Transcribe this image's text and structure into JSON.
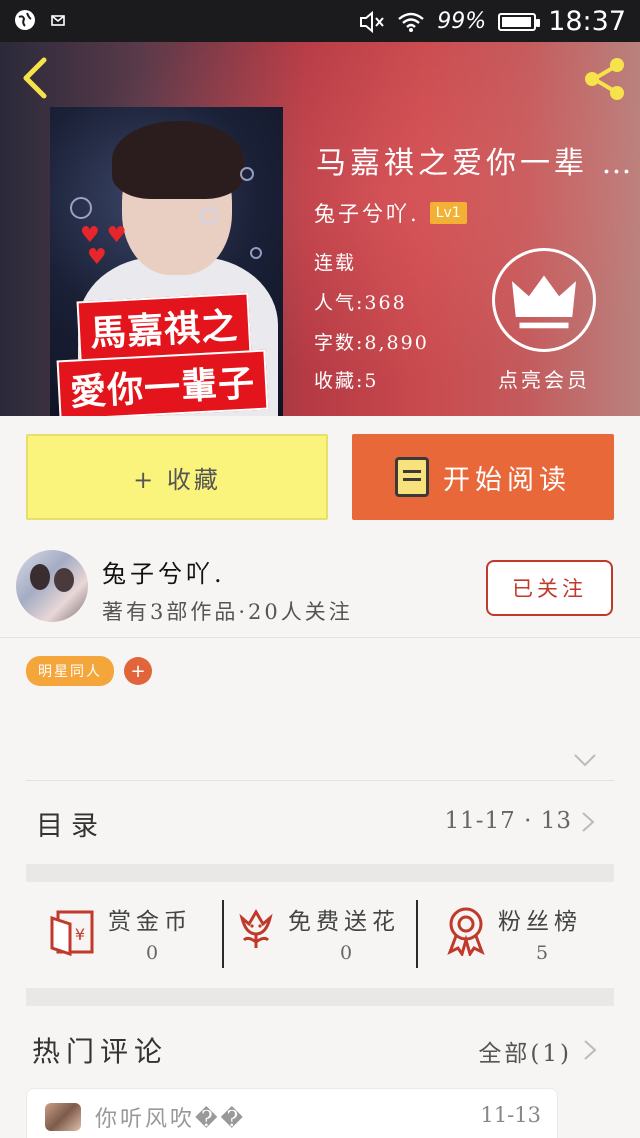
{
  "status_bar": {
    "battery_pct": "99%",
    "time": "18:37",
    "icons": [
      "globe-icon",
      "notification-icon",
      "mute-icon",
      "wifi-icon",
      "battery-icon"
    ]
  },
  "header": {
    "back_icon": "chevron-left-icon",
    "share_icon": "share-icon",
    "cover": {
      "line1": "馬嘉祺之",
      "line2": "愛你一輩子"
    },
    "title": "马嘉祺之爱你一辈 …",
    "author": "兔子兮吖.",
    "level": "Lv1",
    "status": "连载",
    "popularity": "人气:368",
    "word_count": "字数:8,890",
    "favorites": "收藏:5",
    "vip_label": "点亮会员",
    "vip_icon": "crown-icon"
  },
  "actions": {
    "favorite_label": "+ 收藏",
    "read_label": "开始阅读",
    "read_icon": "book-icon"
  },
  "author_card": {
    "name": "兔子兮吖.",
    "stats": "著有3部作品·20人关注",
    "follow_label": "已关注"
  },
  "tags": [
    {
      "label": "明星同人"
    }
  ],
  "tag_add_label": "+",
  "catalog": {
    "label": "目录",
    "date": "11-17 · 13"
  },
  "rewards": [
    {
      "label": "赏金币",
      "count": "0",
      "icon": "red-envelope-icon"
    },
    {
      "label": "免费送花",
      "count": "0",
      "icon": "flower-icon"
    },
    {
      "label": "粉丝榜",
      "count": "5",
      "icon": "medal-icon"
    }
  ],
  "hot_comments": {
    "title": "热门评论",
    "all_label": "全部(1)",
    "items": [
      {
        "name": "你听风吹��",
        "date": "11-13"
      }
    ]
  },
  "colors": {
    "accent_orange": "#e8683a",
    "favorite_yellow": "#fbf47c",
    "follow_red": "#c0392b",
    "level_badge": "#f2b134",
    "tag_orange": "#f5a63b"
  }
}
